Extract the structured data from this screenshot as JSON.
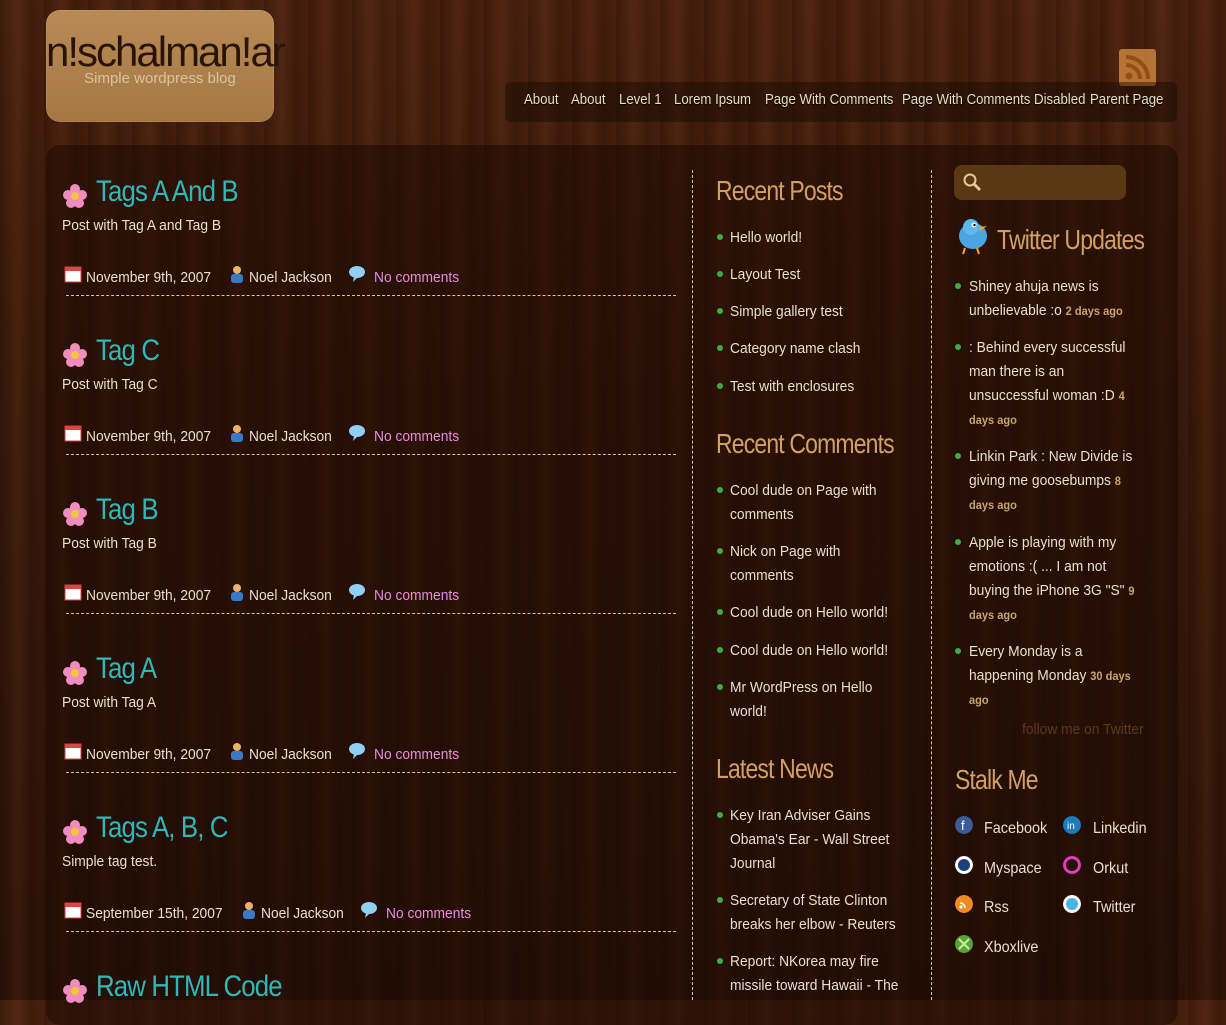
{
  "site": {
    "title": "n!schalman!ar",
    "tagline": "Simple wordpress blog"
  },
  "nav": [
    "About",
    "About",
    "Level 1",
    "Lorem Ipsum",
    "Page With Comments",
    "Page With Comments Disabled",
    "Parent Page"
  ],
  "posts": [
    {
      "title": "Tags A And B",
      "excerpt": "Post with Tag A and Tag B",
      "date": "November 9th, 2007",
      "author": "Noel Jackson",
      "comments": "No comments"
    },
    {
      "title": "Tag C",
      "excerpt": "Post with Tag C",
      "date": "November 9th, 2007",
      "author": "Noel Jackson",
      "comments": "No comments"
    },
    {
      "title": "Tag B",
      "excerpt": "Post with Tag B",
      "date": "November 9th, 2007",
      "author": "Noel Jackson",
      "comments": "No comments"
    },
    {
      "title": "Tag A",
      "excerpt": "Post with Tag A",
      "date": "November 9th, 2007",
      "author": "Noel Jackson",
      "comments": "No comments"
    },
    {
      "title": "Tags A, B, C",
      "excerpt": "Simple tag test.",
      "date": "September 15th, 2007",
      "author": "Noel Jackson",
      "comments": "No comments"
    },
    {
      "title": "Raw HTML Code"
    }
  ],
  "recent_posts": {
    "title": "Recent Posts",
    "items": [
      "Hello world!",
      "Layout Test",
      "Simple gallery test",
      "Category name clash",
      "Test with enclosures"
    ]
  },
  "recent_comments": {
    "title": "Recent Comments",
    "items": [
      {
        "line1": "Cool dude on Page with",
        "line2": "comments"
      },
      {
        "line1": "Nick on Page with",
        "line2": "comments"
      },
      {
        "line1": "Cool dude on Hello world!",
        "line2": ""
      },
      {
        "line1": "Cool dude on Hello world!",
        "line2": ""
      },
      {
        "line1": "Mr WordPress on Hello",
        "line2": "world!"
      }
    ]
  },
  "latest_news": {
    "title": "Latest News",
    "items": [
      {
        "line1": "Key Iran Adviser Gains",
        "line2": "Obama's Ear - Wall Street",
        "line3": "Journal"
      },
      {
        "line1": "Secretary of State Clinton",
        "line2": "breaks her elbow - Reuters",
        "line3": ""
      },
      {
        "line1": "Report: NKorea may fire",
        "line2": "missile toward Hawaii - The",
        "line3": ""
      }
    ]
  },
  "twitter": {
    "title": "Twitter Updates",
    "items": [
      {
        "text": "Shiney ahuja news is unbelievable :o",
        "ago": "2 days ago"
      },
      {
        "text": ": Behind every successful man there is an unsuccessful woman :D",
        "ago": "4 days ago"
      },
      {
        "text": "Linkin Park : New Divide is giving me goosebumps",
        "ago": "8 days ago"
      },
      {
        "text": "Apple is playing with my emotions :( ... I am not buying the iPhone 3G \"S\"",
        "ago": "9 days ago"
      },
      {
        "text": "Every Monday is a happening Monday",
        "ago": "30 days ago"
      }
    ],
    "follow": "follow me on Twitter"
  },
  "stalk": {
    "title": "Stalk Me",
    "items": [
      "Facebook",
      "Linkedin",
      "Myspace",
      "Orkut",
      "Rss",
      "Twitter",
      "Xboxlive"
    ]
  },
  "colors": {
    "post_title": "#2fb8b8",
    "widget_title": "#d3a063",
    "comments_link": "#e98be0",
    "bullet": "#3fae3f"
  }
}
